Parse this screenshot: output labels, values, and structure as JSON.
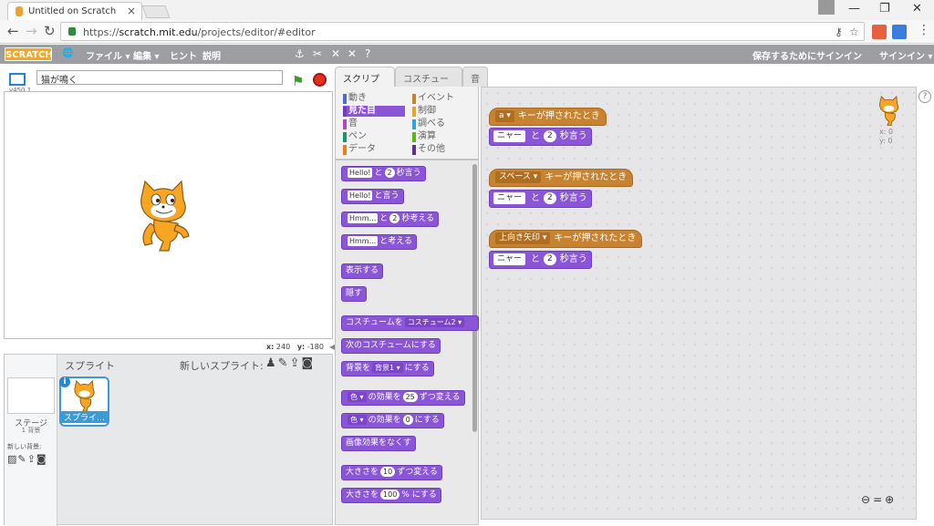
{
  "browser": {
    "tab_title": "Untitled on Scratch",
    "tab_close": "×",
    "url_prefix": "https://",
    "url_host": "scratch.mit.edu",
    "url_path": "/projects/editor/#editor"
  },
  "menubar": {
    "logo": "SCRATCH",
    "items": [
      "ファイル ▾",
      "編集 ▾",
      "ヒント",
      "説明"
    ],
    "save_signin": "保存するためにサインイン",
    "signin": "サインイン ▾"
  },
  "stage": {
    "version": "v450.1",
    "project_title": "猫が鳴く",
    "x_label": "x:",
    "x_value": "240",
    "y_label": "y:",
    "y_value": "-180"
  },
  "sprites": {
    "header": "スプライト",
    "new_sprite": "新しいスプライト:",
    "stage_label": "ステージ",
    "stage_bg_count": "1 背景",
    "new_bg_label": "新しい背景:",
    "sprite_name": "スプライ…",
    "info": "i"
  },
  "editor_tabs": [
    "スクリプト",
    "コスチューム",
    "音"
  ],
  "categories": [
    {
      "label": "動き",
      "color": "#4a6cd4"
    },
    {
      "label": "見た目",
      "color": "#8a55d7"
    },
    {
      "label": "音",
      "color": "#bb42c3"
    },
    {
      "label": "ペン",
      "color": "#0e9a6c"
    },
    {
      "label": "データ",
      "color": "#ee7d16"
    },
    {
      "label": "イベント",
      "color": "#c88330"
    },
    {
      "label": "制御",
      "color": "#e1a91a"
    },
    {
      "label": "調べる",
      "color": "#2ca5e2"
    },
    {
      "label": "演算",
      "color": "#5cb712"
    },
    {
      "label": "その他",
      "color": "#632d99"
    }
  ],
  "palette": {
    "b1_in": "Hello!",
    "b1_mid": "と",
    "b1_num": "2",
    "b1_tail": "秒言う",
    "b2_in": "Hello!",
    "b2_tail": "と言う",
    "b3_in": "Hmm...",
    "b3_mid": "と",
    "b3_num": "2",
    "b3_tail": "秒考える",
    "b4_in": "Hmm...",
    "b4_tail": "と考える",
    "b5": "表示する",
    "b6": "隠す",
    "b7_head": "コスチュームを",
    "b7_dd": "コスチューム2 ▾",
    "b8": "次のコスチュームにする",
    "b9_head": "背景を",
    "b9_dd": "背景1 ▾",
    "b9_tail": "にする",
    "b10_dd": "色 ▾",
    "b10_mid": "の効果を",
    "b10_num": "25",
    "b10_tail": "ずつ変える",
    "b11_dd": "色 ▾",
    "b11_mid": "の効果を",
    "b11_num": "0",
    "b11_tail": "にする",
    "b12": "画像効果をなくす",
    "b13_head": "大きさを",
    "b13_num": "10",
    "b13_tail": "ずつ変える",
    "b14_head": "大きさを",
    "b14_num": "100",
    "b14_tail": "% にする"
  },
  "scripts": [
    {
      "key": "a ▾",
      "hat_tail": "キーが押されたとき",
      "say_in": "ニャー",
      "say_mid": "と",
      "say_num": "2",
      "say_tail": "秒言う"
    },
    {
      "key": "スペース ▾",
      "hat_tail": "キーが押されたとき",
      "say_in": "ニャー",
      "say_mid": "と",
      "say_num": "2",
      "say_tail": "秒言う"
    },
    {
      "key": "上向き矢印 ▾",
      "hat_tail": "キーが押されたとき",
      "say_in": "ニャー",
      "say_mid": "と",
      "say_num": "2",
      "say_tail": "秒言う"
    }
  ],
  "script_area": {
    "sprite_x": "x: 0",
    "sprite_y": "y: 0",
    "help": "?"
  },
  "zoom": "🔍=🔍"
}
